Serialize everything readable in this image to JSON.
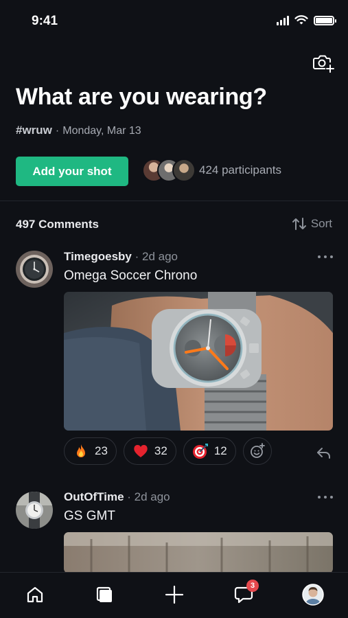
{
  "status": {
    "time": "9:41"
  },
  "header": {
    "title": "What are you wearing?",
    "hashtag": "#wruw",
    "date": "Monday, Mar 13",
    "add_button": "Add your shot",
    "participants": "424 participants"
  },
  "comments_section": {
    "count_label": "497 Comments",
    "sort_label": "Sort"
  },
  "comments": [
    {
      "user": "Timegoesby",
      "time": "2d ago",
      "text": "Omega Soccer Chrono",
      "reactions": [
        {
          "icon": "fire",
          "count": "23"
        },
        {
          "icon": "heart",
          "count": "32"
        },
        {
          "icon": "target",
          "count": "12"
        }
      ]
    },
    {
      "user": "OutOfTime",
      "time": "2d ago",
      "text": "GS GMT"
    }
  ],
  "tabbar": {
    "items": [
      "home-icon",
      "collection-icon",
      "plus-icon",
      "chat-icon",
      "profile-avatar"
    ],
    "chat_badge": "3"
  },
  "colors": {
    "background": "#0f1116",
    "accent": "#1fb882",
    "badge": "#e5484d"
  }
}
